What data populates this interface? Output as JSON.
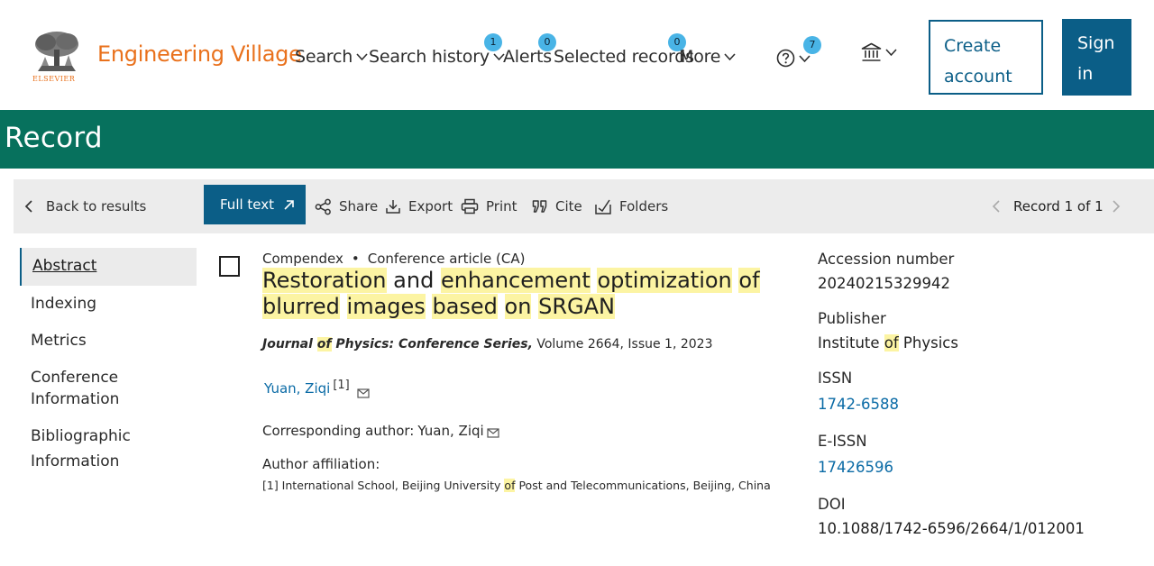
{
  "brand": {
    "name": "Engineering Village",
    "logo_word": "ELSEVIER"
  },
  "nav": {
    "search": "Search",
    "search_history": "Search history",
    "search_history_badge": "1",
    "alerts": "Alerts",
    "alerts_badge": "0",
    "selected_records": "Selected records",
    "selected_records_badge": "0",
    "more": "More",
    "help_badge": "7",
    "create_account_line1": "Create",
    "create_account_line2": "account",
    "sign_in_line1": "Sign",
    "sign_in_line2": "in"
  },
  "header": {
    "title": "Record"
  },
  "toolbar": {
    "back": "Back to results",
    "full_text": "Full text",
    "share": "Share",
    "export": "Export",
    "print": "Print",
    "cite": "Cite",
    "folders": "Folders",
    "record_position": "Record 1 of 1"
  },
  "sidenav": {
    "items": [
      "Abstract",
      "Indexing",
      "Metrics",
      "Conference Information",
      "Bibliographic",
      "Information"
    ]
  },
  "record": {
    "database": "Compendex",
    "doc_type": "Conference article (CA)",
    "title_words": [
      "Restoration",
      "and",
      "enhancement",
      "optimization",
      "of",
      "blurred",
      "images",
      "based",
      "on",
      "SRGAN"
    ],
    "journal": "Journal of Physics: Conference Series,",
    "journal_parts": [
      "Journal ",
      "of",
      " Physics: Conference Series,"
    ],
    "volume_info": " Volume 2664, Issue 1, 2023",
    "author": "Yuan, Ziqi",
    "author_ref": "[1]",
    "corresponding_label": "Corresponding author:",
    "corresponding_author": "Yuan, Ziqi",
    "affiliation_label": "Author affiliation:",
    "affiliation_parts": [
      "[1] International School, Beijing University ",
      "of",
      " Post and Telecommunications, Beijing, China"
    ]
  },
  "details": {
    "accession_label": "Accession number",
    "accession_value": "20240215329942",
    "publisher_label": "Publisher",
    "publisher_parts": [
      "Institute ",
      "of",
      " Physics"
    ],
    "issn_label": "ISSN",
    "issn_value": "1742-6588",
    "eissn_label": "E-ISSN",
    "eissn_value": "17426596",
    "doi_label": "DOI",
    "doi_value": "10.1088/1742-6596/2664/1/012001"
  },
  "colors": {
    "brand_orange": "#e9711c",
    "primary_blue": "#0b5e87",
    "header_green": "#07715d",
    "badge_blue": "#49b4e6",
    "highlight": "#fcf4a3",
    "link": "#0b6ba6"
  },
  "icons": [
    "tree-logo-icon",
    "chevron-down-icon",
    "help-circle-icon",
    "institution-icon",
    "chevron-left-icon",
    "chevron-right-icon",
    "external-link-icon",
    "share-icon",
    "download-icon",
    "printer-icon",
    "quote-icon",
    "folder-add-icon",
    "mail-icon"
  ]
}
